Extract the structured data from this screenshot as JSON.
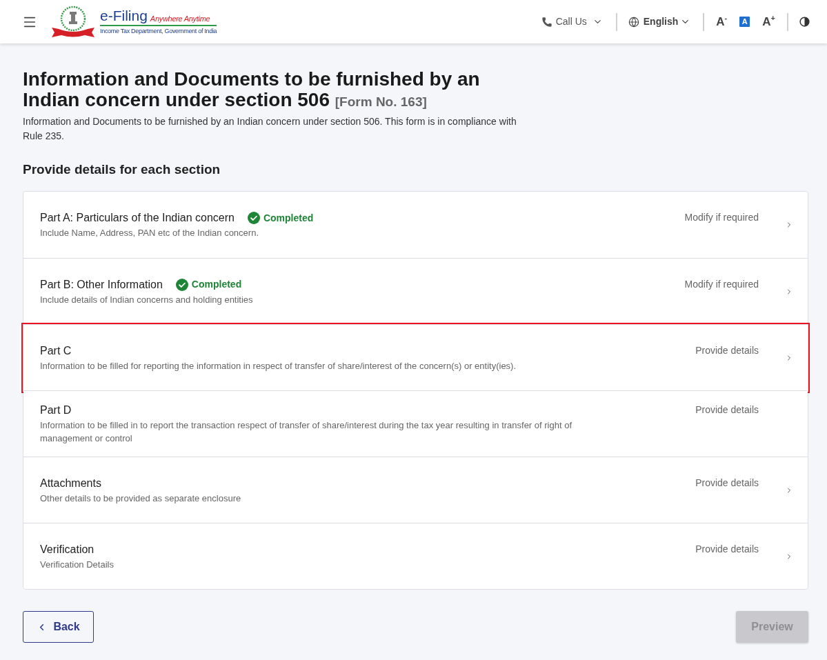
{
  "header": {
    "logo": {
      "title": "e-Filing",
      "tagline": "Anywhere Anytime",
      "subtitle": "Income Tax Department, Government of India"
    },
    "call_us": "Call Us",
    "language": "English",
    "text_size": [
      {
        "label": "A$^{-}$",
        "selected": false
      },
      {
        "label": "A",
        "selected": true
      },
      {
        "label": "A$^{+}$",
        "selected": false
      }
    ]
  },
  "page": {
    "title": "Information and Documents to be furnished by an Indian concern under section 506",
    "form_number": "[Form No. 163]",
    "description": "Information and Documents to be furnished by an Indian concern under section 506. This form is in compliance with Rule 235.",
    "section_heading": "Provide details for each section"
  },
  "sections": [
    {
      "title": "Part A: Particulars of the Indian concern",
      "status": "Completed",
      "description": "Include Name, Address, PAN etc of the Indian concern.",
      "action": "Modify if required",
      "arrow": true,
      "highlighted": false
    },
    {
      "title": "Part B: Other Information",
      "status": "Completed",
      "description": "Include details of Indian concerns and holding entities",
      "action": "Modify if required",
      "arrow": true,
      "highlighted": false
    },
    {
      "title": "Part C",
      "description": "Information to be filled for reporting the information in respect of transfer of share/interest of the concern(s) or entity(ies).",
      "action": "Provide details",
      "arrow": true,
      "highlighted": true
    },
    {
      "title": "Part D",
      "description": "Information to be filled in to report the transaction respect of transfer of share/interest during the tax year resulting in transfer of right of management or control",
      "action": "Provide details",
      "arrow": false,
      "highlighted": false
    },
    {
      "title": "Attachments",
      "description": "Other details to be provided as separate enclosure",
      "action": "Provide details",
      "arrow": true,
      "highlighted": false
    },
    {
      "title": "Verification",
      "description": "Verification Details",
      "action": "Provide details",
      "arrow": true,
      "highlighted": false
    }
  ],
  "footer": {
    "back": "Back",
    "preview": {
      "label": "Preview",
      "disabled": true
    }
  }
}
